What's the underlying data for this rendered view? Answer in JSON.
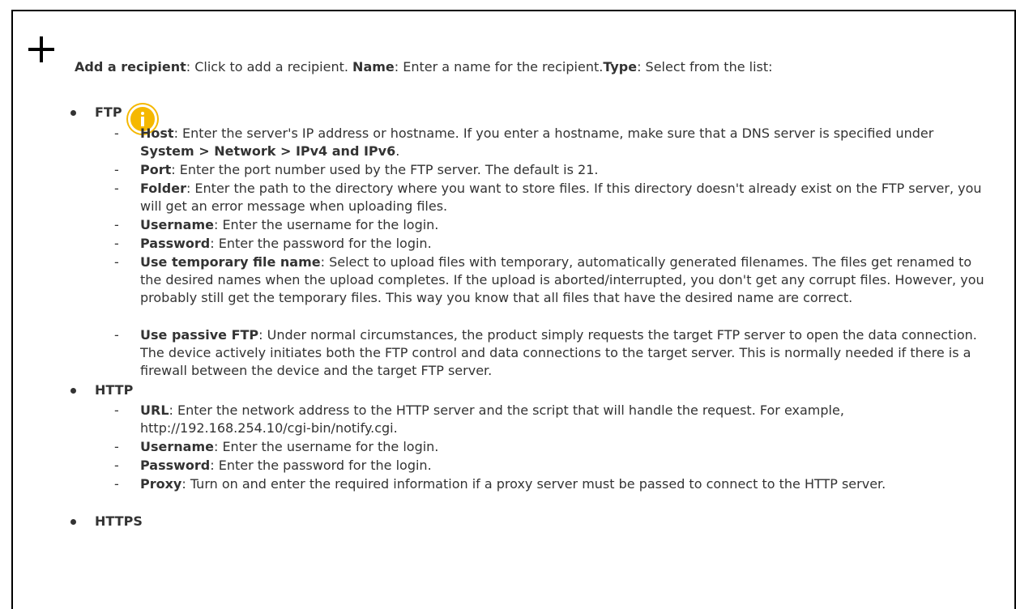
{
  "intro": {
    "add_label": "Add a recipient",
    "add_text": ": Click to add a recipient. ",
    "name_label": "Name",
    "name_text": ": Enter a name for the recipient.",
    "type_label": "Type",
    "type_text": ": Select from the list:"
  },
  "ftp": {
    "label": "FTP",
    "host": {
      "label": "Host",
      "text": ": Enter the server's IP address or hostname. If you enter a hostname, make sure that a DNS server is specified under ",
      "path": "System > Network > IPv4 and IPv6",
      "end": "."
    },
    "port": {
      "label": "Port",
      "text": ": Enter the port number used by the FTP server. The default is 21."
    },
    "folder": {
      "label": "Folder",
      "text": ": Enter the path to the directory where you want to store files. If this directory doesn't already exist on the FTP server, you will get an error message when uploading files."
    },
    "username": {
      "label": "Username",
      "text": ": Enter the username for the login."
    },
    "password": {
      "label": "Password",
      "text": ": Enter the password for the login."
    },
    "temp": {
      "label": "Use temporary file name",
      "text": ": Select to upload files with temporary, automatically generated filenames. The files get renamed to the desired names when the upload completes. If the upload is aborted/interrupted, you don't get any corrupt files. However, you probably still get the temporary files. This way you know that all files that have the desired name are correct."
    },
    "passive": {
      "label": "Use passive FTP",
      "text": ": Under normal circumstances, the product simply requests the target FTP server to open the data connection. The device actively initiates both the FTP control and data connections to the target server. This is normally needed if there is a firewall between the device and the target FTP server."
    }
  },
  "http": {
    "label": "HTTP",
    "url": {
      "label": "URL",
      "text": ": Enter the network address to the HTTP server and the script that will handle the request. For example, http://192.168.254.10/cgi-bin/notify.cgi."
    },
    "username": {
      "label": "Username",
      "text": ": Enter the username for the login."
    },
    "password": {
      "label": "Password",
      "text": ": Enter the password for the login."
    },
    "proxy": {
      "label": "Proxy",
      "text": ": Turn on and enter the required information if a proxy server must be passed to connect to the HTTP server."
    }
  },
  "https": {
    "label": "HTTPS"
  },
  "dash": "-",
  "icons": {
    "add": "plus-icon",
    "info": "info-icon"
  },
  "colors": {
    "info": "#f5b800",
    "text": "#333333"
  }
}
